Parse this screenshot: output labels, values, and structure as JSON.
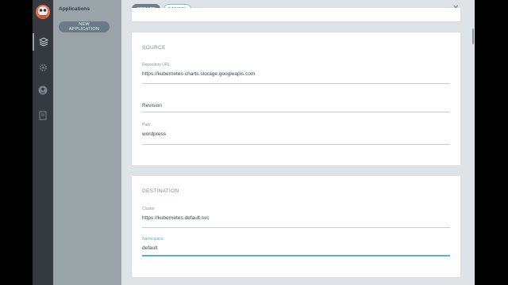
{
  "sidebar": {
    "title": "Applications",
    "new_app_label": "NEW APPLICATION",
    "nav_icons": [
      "apps-icon",
      "settings-icon",
      "user-icon",
      "docs-icon"
    ]
  },
  "toolbar": {
    "create_label": "CREATE",
    "cancel_label": "CANCEL",
    "close_label": "✕"
  },
  "source": {
    "heading": "SOURCE",
    "repo_label": "Repository URL",
    "repo_value": "https://kubernetes-charts.storage.googleapis.com",
    "revision_label": "Revision",
    "revision_value": "",
    "path_label": "Path",
    "path_value": "wordpress"
  },
  "destination": {
    "heading": "DESTINATION",
    "cluster_label": "Cluster",
    "cluster_value": "https://kubernetes.default.svc",
    "namespace_label": "Namespace",
    "namespace_value": "default"
  },
  "colors": {
    "accent": "#5fb2bd",
    "rail": "#343a40",
    "sidebar": "#9aa3a8"
  }
}
